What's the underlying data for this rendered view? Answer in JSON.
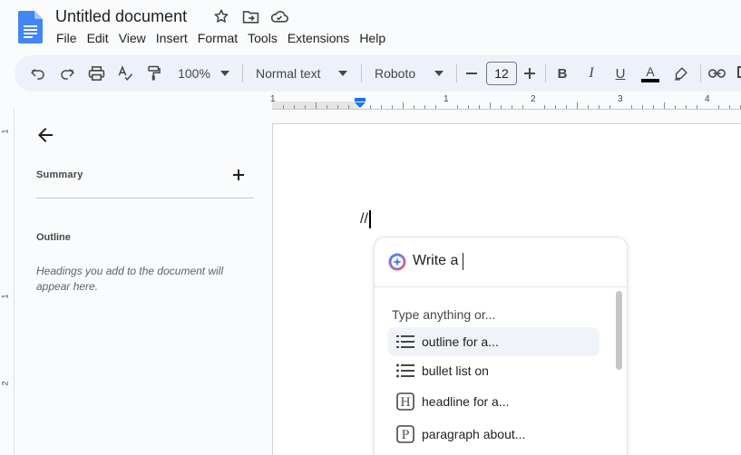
{
  "document": {
    "title": "Untitled document"
  },
  "menu": [
    "File",
    "Edit",
    "View",
    "Insert",
    "Format",
    "Tools",
    "Extensions",
    "Help"
  ],
  "toolbar": {
    "zoom": "100%",
    "style": "Normal text",
    "font": "Roboto",
    "font_size": "12",
    "bold": "B",
    "italic": "I",
    "underline": "U",
    "text_color_glyph": "A",
    "text_color": "#000000"
  },
  "ruler": {
    "labels": [
      "1",
      "1",
      "2",
      "3",
      "4"
    ],
    "vertical_labels": [
      "1",
      "1",
      "2"
    ]
  },
  "outline_panel": {
    "summary_label": "Summary",
    "outline_label": "Outline",
    "hint": "Headings you add to the document will appear here."
  },
  "page": {
    "text": "//"
  },
  "ai_popup": {
    "input_text": "Write a",
    "hint": "Type anything or...",
    "suggestions": [
      {
        "label": "outline for a...",
        "icon": "numbered-list-icon",
        "active": true
      },
      {
        "label": "bullet list on",
        "icon": "bullet-list-icon",
        "active": false
      },
      {
        "label": "headline for a...",
        "icon": "heading-icon",
        "icon_letter": "H",
        "active": false
      },
      {
        "label": "paragraph about...",
        "icon": "paragraph-icon",
        "icon_letter": "P",
        "active": false
      }
    ]
  },
  "colors": {
    "docs_blue": "#4285f4",
    "toolbar_bg": "#edf2fa",
    "app_bg": "#f9fbfd",
    "ruler_marker": "#1a73e8"
  }
}
